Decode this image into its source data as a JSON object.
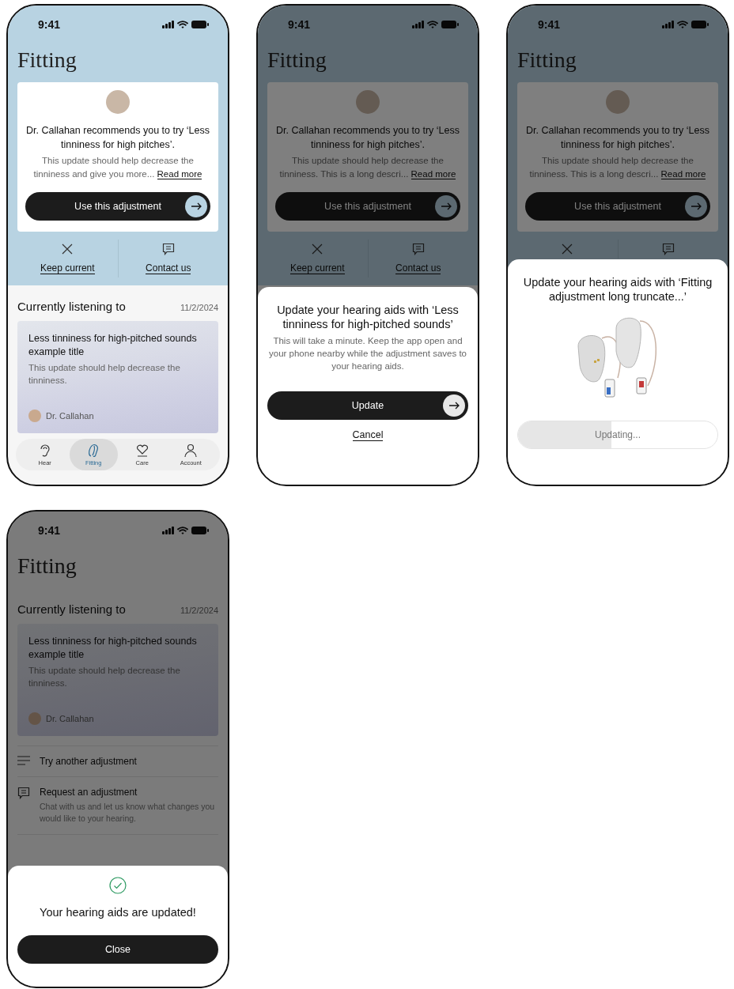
{
  "screens": [
    {
      "time": "9:41",
      "title": "Fitting",
      "dimmed": false,
      "recommendation": {
        "headline": "Dr. Callahan recommends you to try ‘Less tinniness for high pitches’.",
        "body": "This update should help decrease the tinniness and give you more...",
        "read_more": "Read more",
        "button": "Use this adjustment"
      },
      "actions": [
        {
          "kind": "keep",
          "label": "Keep current"
        },
        {
          "kind": "contact",
          "label": "Contact us"
        }
      ],
      "current": {
        "heading": "Currently listening to",
        "date": "11/2/2024",
        "title": "Less tinniness for high-pitched sounds example title",
        "body": "This update should help decrease the tinniness.",
        "author": "Dr. Callahan"
      },
      "nav": [
        {
          "kind": "ear",
          "label": "Hear",
          "selected": false
        },
        {
          "kind": "aid",
          "label": "Fitting",
          "selected": true
        },
        {
          "kind": "heart",
          "label": "Care",
          "selected": false
        },
        {
          "kind": "person",
          "label": "Account",
          "selected": false
        }
      ]
    },
    {
      "time": "9:41",
      "title": "Fitting",
      "dimmed": true,
      "recommendation": {
        "headline": "Dr. Callahan recommends you to try ‘Less tinniness for high pitches’.",
        "body": "This update should help decrease the tinniness. This is a long descri...",
        "read_more": "Read more",
        "button": "Use this adjustment"
      },
      "actions": [
        {
          "kind": "keep",
          "label": "Keep current"
        },
        {
          "kind": "contact",
          "label": "Contact us"
        }
      ],
      "sheet": {
        "kind": "confirm",
        "title": "Update your hearing aids with ‘Less tinniness for high-pitched sounds’",
        "body": "This will take a minute. Keep the app open and your phone nearby while the adjustment saves to your hearing aids.",
        "button": "Update",
        "link": "Cancel"
      }
    },
    {
      "time": "9:41",
      "title": "Fitting",
      "dimmed": true,
      "recommendation": {
        "headline": "Dr. Callahan recommends you to try ‘Less tinniness for high pitches’.",
        "body": "This update should help decrease the tinniness. This is a long descri...",
        "read_more": "Read more",
        "button": "Use this adjustment"
      },
      "actions": [
        {
          "kind": "keep"
        },
        {
          "kind": "contact"
        }
      ],
      "sheet": {
        "kind": "progress",
        "title": "Update your hearing aids with ‘Fitting adjustment long truncate...’",
        "progress": {
          "label": "Updating...",
          "level": 0.47
        }
      }
    },
    {
      "time": "9:41",
      "title": "Fitting",
      "dimmed": true,
      "current": {
        "heading": "Currently listening to",
        "date": "11/2/2024",
        "title": "Less tinniness for high-pitched sounds example title",
        "body": "This update should help decrease the tinniness.",
        "author": "Dr. Callahan"
      },
      "options": [
        {
          "kind": "menu",
          "title": "Try another adjustment"
        },
        {
          "kind": "chat",
          "title": "Request an adjustment",
          "body": "Chat with us and let us know what changes you would like to your hearing."
        }
      ],
      "sheet": {
        "kind": "success",
        "title": "Your hearing aids are updated!",
        "button": "Close"
      }
    }
  ]
}
